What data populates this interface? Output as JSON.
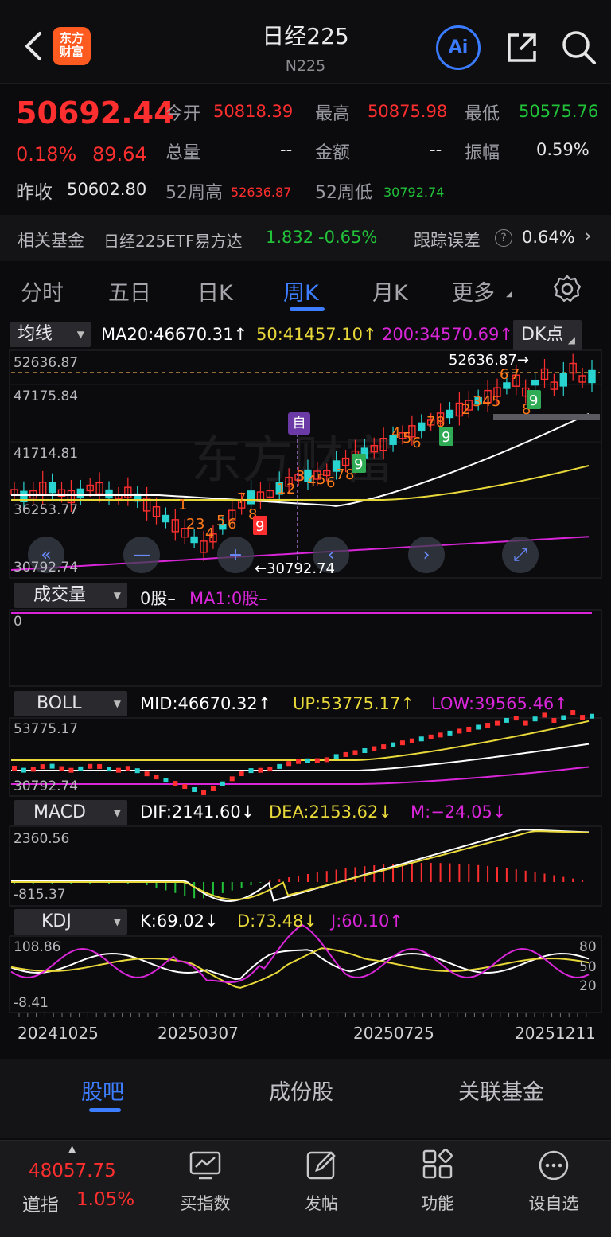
{
  "header": {
    "title": "日经225",
    "subtitle": "N225",
    "logo_text": "东方\n财富",
    "ai_label": "Ai"
  },
  "quote": {
    "price": "50692.44",
    "change_pct": "0.18%",
    "change_abs": "89.64",
    "open_label": "今开",
    "open": "50818.39",
    "high_label": "最高",
    "high": "50875.98",
    "low_label": "最低",
    "low": "50575.76",
    "volume_label": "总量",
    "volume": "--",
    "amount_label": "金额",
    "amount": "--",
    "amplitude_label": "振幅",
    "amplitude": "0.59%",
    "prev_close_label": "昨收",
    "prev_close": "50602.80",
    "w52_high_label": "52周高",
    "w52_high": "52636.87",
    "w52_low_label": "52周低",
    "w52_low": "30792.74"
  },
  "fund": {
    "label": "相关基金",
    "name": "日经225ETF易方达",
    "price": "1.832",
    "change": "-0.65%",
    "track_label": "跟踪误差",
    "track_value": "0.64%"
  },
  "tabs": [
    "分时",
    "五日",
    "日K",
    "周K",
    "月K",
    "更多"
  ],
  "active_tab": "周K",
  "main_chart": {
    "indicator_label": "均线",
    "ma20": "MA20:46670.31↑",
    "ma50": "50:41457.10↑",
    "ma200": "200:34570.69↑",
    "dk_label": "DK点",
    "y_ticks": [
      "52636.87",
      "47175.84",
      "41714.81",
      "36253.77",
      "30792.74"
    ],
    "high_marker": "52636.87",
    "low_marker": "30792.74",
    "self_marker": "自"
  },
  "volume": {
    "label": "成交量",
    "text": "0股–",
    "ma_text": "MA1:0股–",
    "y_tick": "0"
  },
  "boll": {
    "label": "BOLL",
    "mid": "MID:46670.32↑",
    "up": "UP:53775.17↑",
    "low": "LOW:39565.46↑",
    "y_top": "53775.17",
    "y_bottom": "30792.74"
  },
  "macd": {
    "label": "MACD",
    "dif": "DIF:2141.60↓",
    "dea": "DEA:2153.62↓",
    "m": "M:−24.05↓",
    "y_top": "2360.56",
    "y_bottom": "-815.37"
  },
  "kdj": {
    "label": "KDJ",
    "k": "K:69.02↓",
    "d": "D:73.48↓",
    "j": "J:60.10↑",
    "y_top": "108.86",
    "y_bottom": "-8.41",
    "levels": [
      "80",
      "50",
      "20"
    ]
  },
  "x_labels": [
    "20241025",
    "20250307",
    "20250725",
    "20251211"
  ],
  "subtabs": [
    "股吧",
    "成份股",
    "关联基金"
  ],
  "active_subtab": "股吧",
  "bottom": {
    "index_value": "48057.75",
    "index_name": "道指",
    "index_change": "1.05%",
    "items": [
      "买指数",
      "发帖",
      "功能",
      "设自选"
    ]
  },
  "colors": {
    "up": "#ff2f2f",
    "down": "#21c23a",
    "accent": "#3a7bff",
    "ma20": "#ffffff",
    "ma50": "#e8d83a",
    "ma200": "#d926d9",
    "td_orange": "#ff7a1a",
    "td_green": "#2faa55"
  }
}
